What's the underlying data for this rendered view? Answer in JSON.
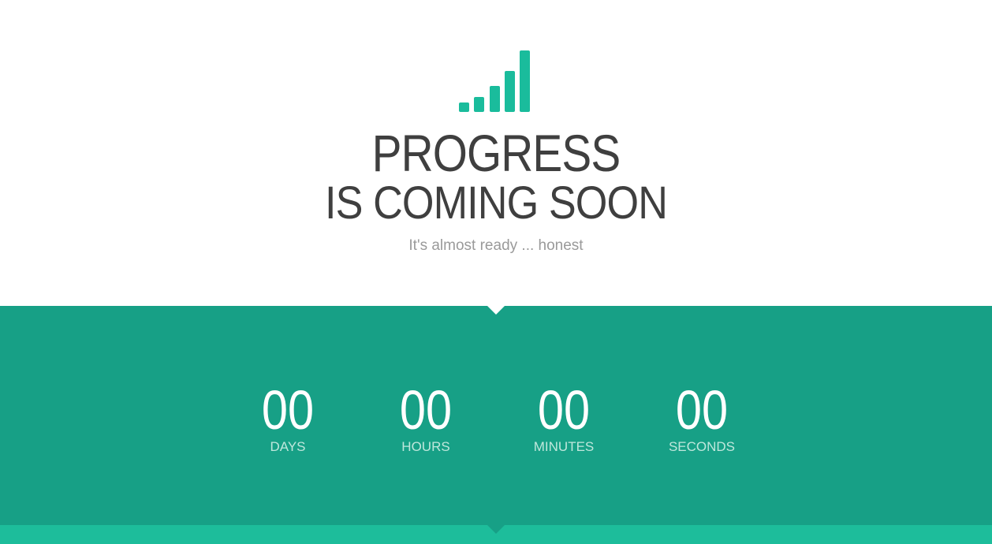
{
  "colors": {
    "accent": "#1abc9c",
    "band": "#17a086",
    "footer": "#1dbd9b",
    "heading": "#3f3f3f",
    "muted": "#9a9a9a"
  },
  "logo": {
    "icon": "signal-bars-icon"
  },
  "hero": {
    "title_line1": "PROGRESS",
    "title_line2": "IS COMING SOON",
    "tagline": "It's almost ready ... honest"
  },
  "countdown": {
    "units": [
      {
        "value": "00",
        "label": "DAYS"
      },
      {
        "value": "00",
        "label": "HOURS"
      },
      {
        "value": "00",
        "label": "MINUTES"
      },
      {
        "value": "00",
        "label": "SECONDS"
      }
    ]
  }
}
